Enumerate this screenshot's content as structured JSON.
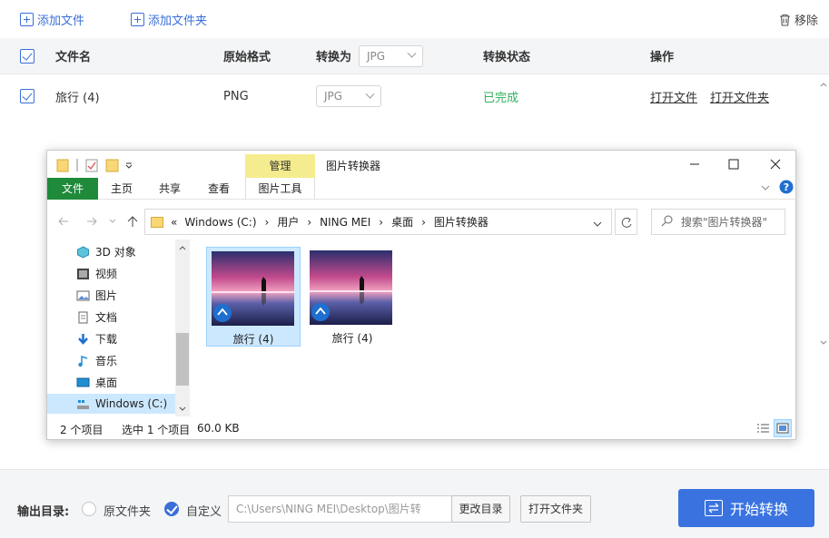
{
  "toolbar": {
    "add_file": "添加文件",
    "add_folder": "添加文件夹",
    "remove": "移除"
  },
  "table": {
    "headers": {
      "filename": "文件名",
      "original_format": "原始格式",
      "convert_to": "转换为",
      "convert_to_value": "JPG",
      "status": "转换状态",
      "actions": "操作"
    },
    "rows": [
      {
        "filename": "旅行 (4)",
        "format": "PNG",
        "target": "JPG",
        "status": "已完成",
        "open_file": "打开文件",
        "open_folder": "打开文件夹"
      }
    ]
  },
  "explorer": {
    "title": "图片转换器",
    "manage_tab": "管理",
    "ribbon_tabs": [
      "文件",
      "主页",
      "共享",
      "查看",
      "图片工具"
    ],
    "breadcrumb": [
      "«",
      "Windows (C:)",
      "›",
      "用户",
      "›",
      "NING MEI",
      "›",
      "桌面",
      "›",
      "图片转换器"
    ],
    "search_placeholder": "搜索\"图片转换器\"",
    "nav_items": [
      {
        "label": "3D 对象",
        "icon": "3d-objects-icon"
      },
      {
        "label": "视频",
        "icon": "video-icon"
      },
      {
        "label": "图片",
        "icon": "pictures-icon"
      },
      {
        "label": "文档",
        "icon": "documents-icon"
      },
      {
        "label": "下载",
        "icon": "download-icon"
      },
      {
        "label": "音乐",
        "icon": "music-icon"
      },
      {
        "label": "桌面",
        "icon": "desktop-icon"
      },
      {
        "label": "Windows (C:)",
        "icon": "drive-icon"
      }
    ],
    "files": [
      {
        "name": "旅行 (4)",
        "selected": true
      },
      {
        "name": "旅行 (4)",
        "selected": false
      }
    ],
    "status": {
      "items": "2 个项目",
      "selected": "选中 1 个项目",
      "size": "60.0 KB"
    }
  },
  "output": {
    "label": "输出目录:",
    "option_original": "原文件夹",
    "option_custom": "自定义",
    "path": "C:\\Users\\NING MEI\\Desktop\\图片转",
    "change_dir": "更改目录",
    "open_folder": "打开文件夹",
    "start": "开始转换"
  },
  "colors": {
    "accent": "#3a73e0",
    "done": "#2fb15a",
    "manage_tab": "#f5ec8f",
    "ribbon_file": "#1e8a3a"
  }
}
